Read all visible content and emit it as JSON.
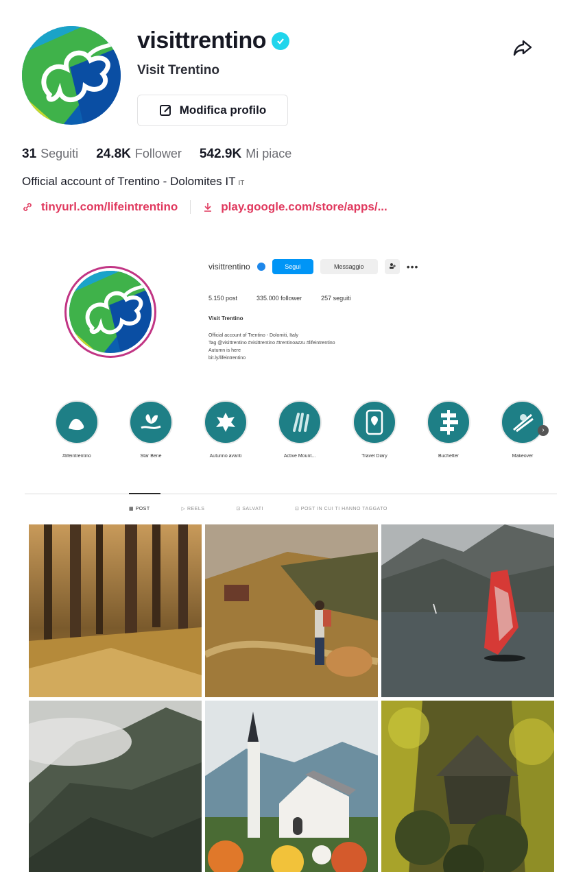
{
  "tiktok": {
    "username": "visittrentino",
    "display_name": "Visit Trentino",
    "edit_profile_label": "Modifica profilo",
    "stats": [
      {
        "value": "31",
        "label": "Seguiti"
      },
      {
        "value": "24.8K",
        "label": "Follower"
      },
      {
        "value": "542.9K",
        "label": "Mi piace"
      }
    ],
    "bio": "Official account of Trentino - Dolomites IT",
    "bio_flag": "IT",
    "links": [
      {
        "text": "tinyurl.com/lifeintrentino"
      },
      {
        "text": "play.google.com/store/apps/..."
      }
    ],
    "colors": {
      "link": "#e0395e",
      "verified": "#20d5ec"
    }
  },
  "instagram": {
    "username": "visittrentino",
    "follow_label": "Segui",
    "message_label": "Messaggio",
    "posts": "5.150 post",
    "followers": "335.000 follower",
    "following": "257 seguiti",
    "name": "Visit Trentino",
    "bio_lines": [
      "Official account of Trentino - Dolomiti, Italy",
      "Tag @visittrentino #visittrentino #trentinoazzu #lifeintrentino",
      "Autumn is here",
      "bit.ly/lifeintrentino"
    ],
    "highlights": [
      {
        "label": "#lifeintrentino",
        "icon": "hat-icon"
      },
      {
        "label": "Star Bene",
        "icon": "hand-plant-icon"
      },
      {
        "label": "Autunno avanti",
        "icon": "leaf-icon"
      },
      {
        "label": "Active Mount...",
        "icon": "feathers-icon"
      },
      {
        "label": "Travel Diary",
        "icon": "phone-pin-icon"
      },
      {
        "label": "Buchetter",
        "icon": "signpost-icon"
      },
      {
        "label": "Makeover",
        "icon": "ski-icon"
      }
    ],
    "tabs": [
      {
        "label": "POST",
        "active": true
      },
      {
        "label": "REELS",
        "active": false
      },
      {
        "label": "SALVATI",
        "active": false
      },
      {
        "label": "POST IN CUI TI HANNO TAGGATO",
        "active": false
      }
    ],
    "grid_photos": [
      {
        "scene": "autumn-forest"
      },
      {
        "scene": "hiker-mountain-trail"
      },
      {
        "scene": "windsurfer-lake"
      },
      {
        "scene": "misty-mountains"
      },
      {
        "scene": "church-autumn-leaves"
      },
      {
        "scene": "hut-in-larch-forest"
      }
    ]
  }
}
